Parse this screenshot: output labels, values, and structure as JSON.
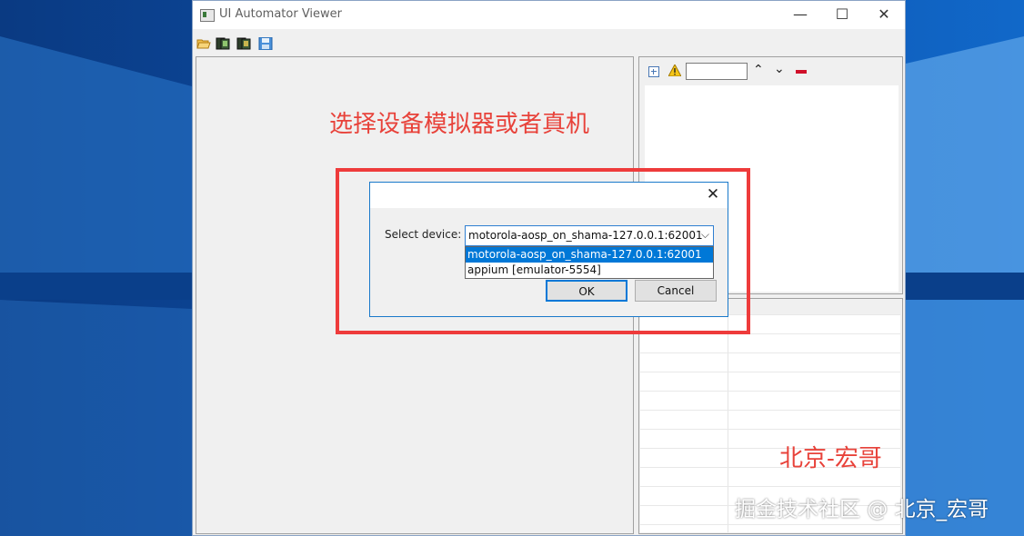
{
  "window": {
    "title": "UI Automator Viewer",
    "controls": {
      "minimize": "—",
      "maximize": "☐",
      "close": "✕"
    }
  },
  "toolbar": {
    "icons": [
      "open-icon",
      "device-screenshot-icon",
      "device-screenshot-compressed-icon",
      "save-icon"
    ]
  },
  "hierarchy_toolbar": {
    "icons": [
      "expand-all-icon",
      "warning-icon",
      "search-input",
      "up-arrow-icon",
      "down-arrow-icon",
      "clear-icon"
    ],
    "up_arrow": "⌃",
    "down_arrow": "⌄",
    "search_value": ""
  },
  "annotations": {
    "select_caption": "选择设备模拟器或者真机",
    "author_caption": "北京-宏哥",
    "watermark": "掘金技术社区 @ 北京_宏哥",
    "highlight_color": "#ee3b3b"
  },
  "dialog": {
    "close": "✕",
    "label": "Select device:",
    "selected": "motorola-aosp_on_shama-127.0.0.1:62001",
    "chevron": "⌵",
    "options": [
      "motorola-aosp_on_shama-127.0.0.1:62001",
      "appium [emulator-5554]"
    ],
    "ok_label": "OK",
    "cancel_label": "Cancel"
  },
  "colors": {
    "desktop": "#0b3f86",
    "window_bg": "#f0f0f0",
    "selection": "#0078d7",
    "caption": "#e8423a"
  }
}
